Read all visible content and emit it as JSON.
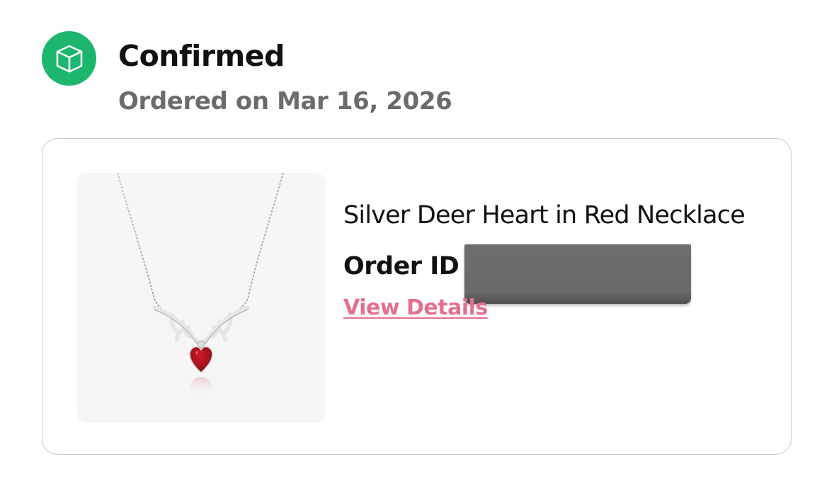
{
  "status": {
    "icon": "package-box-icon",
    "title": "Confirmed",
    "ordered_on": "Ordered on Mar 16, 2026",
    "icon_color": "#1db66f"
  },
  "order_card": {
    "product_image": "silver-deer-heart-necklace-image",
    "product_name": "Silver Deer Heart in Red Necklace",
    "order_id_label": "Order ID",
    "view_details_label": "View Details",
    "link_color": "#e4708d"
  }
}
